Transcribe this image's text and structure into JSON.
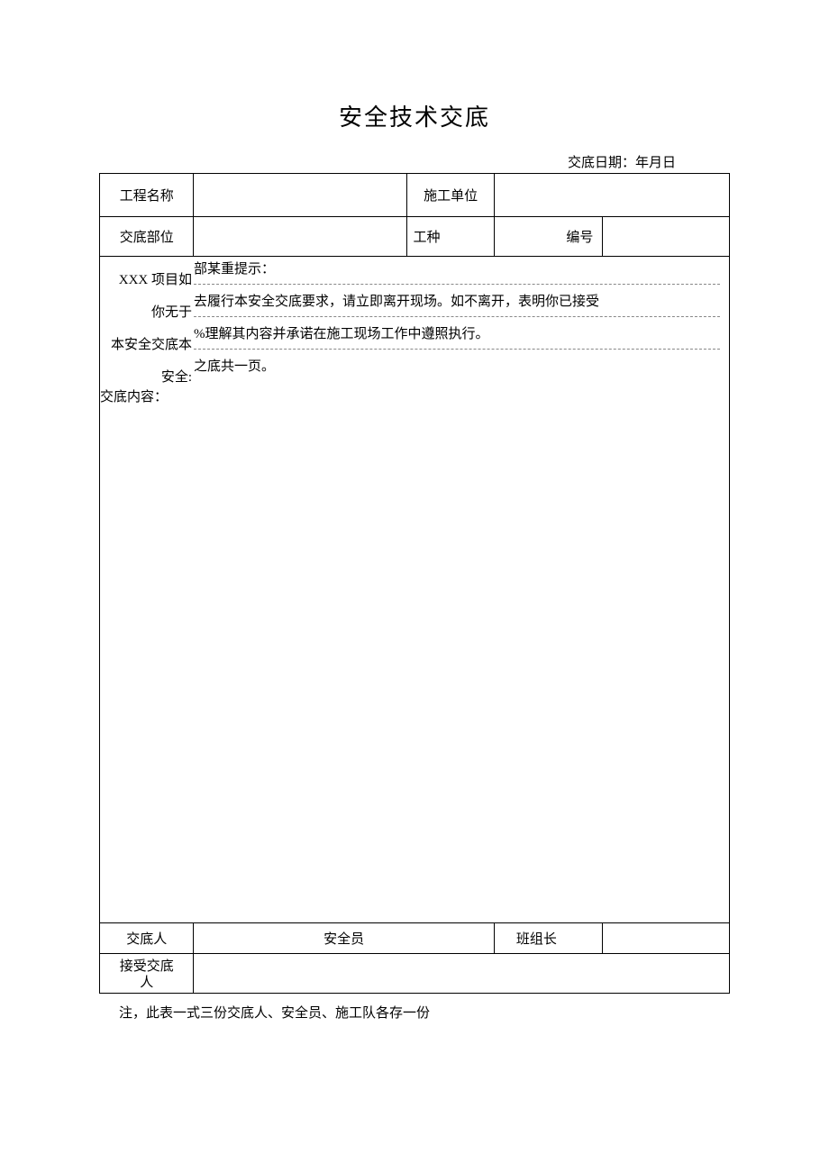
{
  "title": "安全技术交底",
  "date_label": "交底日期：年月日",
  "row1": {
    "label1": "工程名称",
    "value1": "",
    "label2": "施工单位",
    "value2": ""
  },
  "row2": {
    "label1": "交底部位",
    "value1": "",
    "label2": "工种",
    "label3": "编号",
    "value3": ""
  },
  "body": {
    "left1": "XXX 项目如",
    "right1": "部某重提示：",
    "left2": "你无于",
    "right2": "去履行本安全交底要求，请立即离开现场。如不离开，表明你已接受",
    "left3": "本安全交底本",
    "right3": "%理解其内容并承诺在施工现场工作中遵照执行。",
    "left4": "安全:",
    "right4": "之底共一页。",
    "content_label": "交底内容："
  },
  "footer1": {
    "label1": "交底人",
    "label2": "安全员",
    "label3": "班组长"
  },
  "footer2": {
    "label1_line1": "接受交底",
    "label1_line2": "人",
    "value": ""
  },
  "note": "注，此表一式三份交底人、安全员、施工队各存一份"
}
